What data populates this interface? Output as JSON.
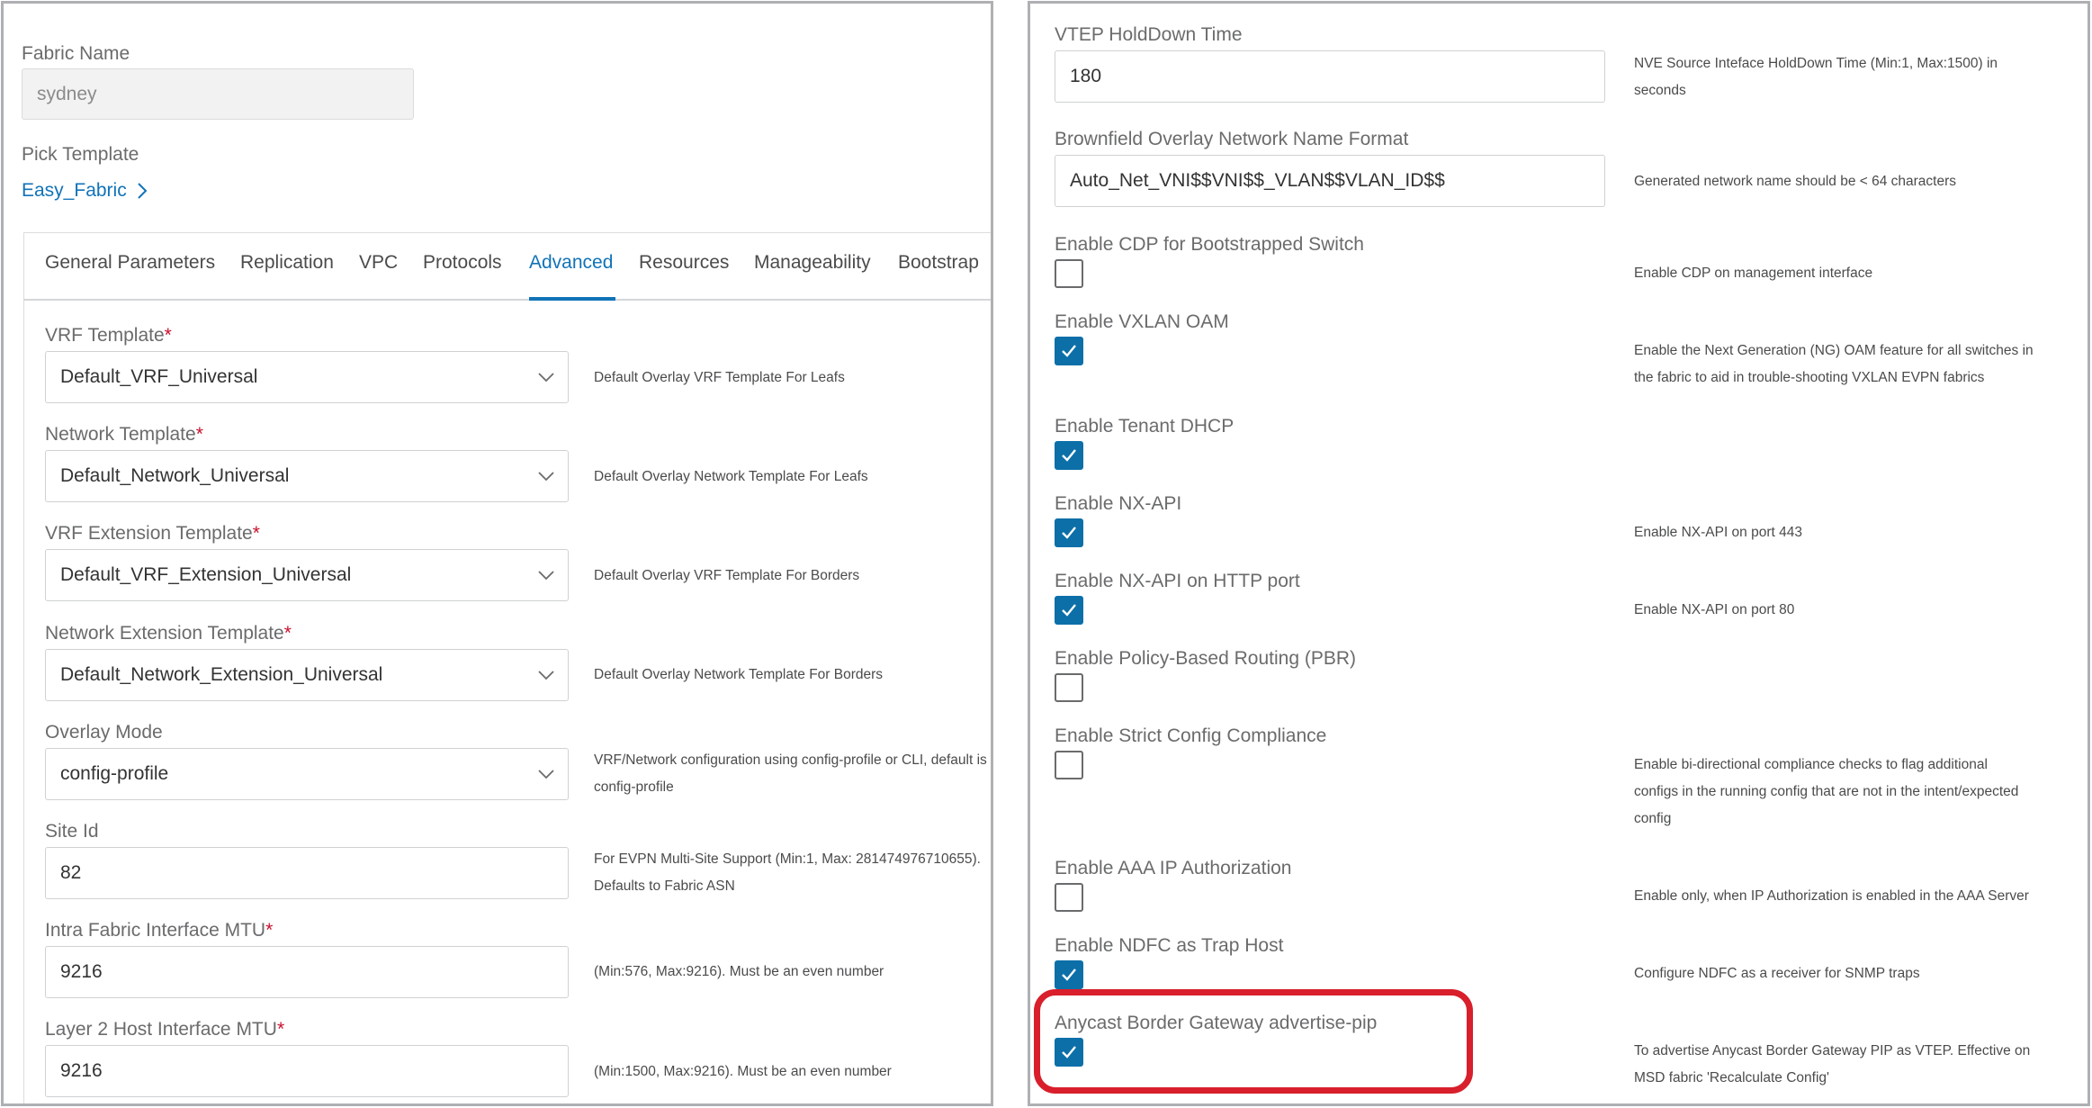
{
  "left": {
    "fabric_name_label": "Fabric Name",
    "fabric_name_value": "sydney",
    "pick_template_label": "Pick Template",
    "template_link": "Easy_Fabric",
    "tabs": [
      {
        "label": "General Parameters"
      },
      {
        "label": "Replication"
      },
      {
        "label": "VPC"
      },
      {
        "label": "Protocols"
      },
      {
        "label": "Advanced"
      },
      {
        "label": "Resources"
      },
      {
        "label": "Manageability"
      },
      {
        "label": "Bootstrap"
      }
    ],
    "active_tab": "Advanced",
    "fields": {
      "vrf_template": {
        "label": "VRF Template",
        "value": "Default_VRF_Universal",
        "hint": "Default Overlay VRF Template For Leafs"
      },
      "network_template": {
        "label": "Network Template",
        "value": "Default_Network_Universal",
        "hint": "Default Overlay Network Template For Leafs"
      },
      "vrf_ext_template": {
        "label": "VRF Extension Template",
        "value": "Default_VRF_Extension_Universal",
        "hint": "Default Overlay VRF Template For Borders"
      },
      "net_ext_template": {
        "label": "Network Extension Template",
        "value": "Default_Network_Extension_Universal",
        "hint": "Default Overlay Network Template For Borders"
      },
      "overlay_mode": {
        "label": "Overlay Mode",
        "value": "config-profile",
        "hint_1": "VRF/Network configuration using config-profile or CLI, default is",
        "hint_2": "config-profile"
      },
      "site_id": {
        "label": "Site Id",
        "value": "82",
        "hint_1": "For EVPN Multi-Site Support (Min:1, Max: 281474976710655).",
        "hint_2": "Defaults to Fabric ASN"
      },
      "intra_mtu": {
        "label": "Intra Fabric Interface MTU",
        "value": "9216",
        "hint": "(Min:576, Max:9216). Must be an even number"
      },
      "l2_mtu": {
        "label": "Layer 2 Host Interface MTU",
        "value": "9216",
        "hint": "(Min:1500, Max:9216). Must be an even number"
      }
    },
    "required_mark": "*"
  },
  "right": {
    "vtep_holddown": {
      "label": "VTEP HoldDown Time",
      "value": "180",
      "hint_1": "NVE Source Inteface HoldDown Time (Min:1, Max:1500) in",
      "hint_2": "seconds"
    },
    "brownfield_format": {
      "label": "Brownfield Overlay Network Name Format",
      "value": "Auto_Net_VNI$$VNI$$_VLAN$$VLAN_ID$$",
      "hint": "Generated network name should be < 64 characters"
    },
    "checkboxes": [
      {
        "label": "Enable CDP for Bootstrapped Switch",
        "checked": false,
        "hint_1": "Enable CDP on management interface",
        "hint_2": "",
        "hint_3": ""
      },
      {
        "label": "Enable VXLAN OAM",
        "checked": true,
        "hint_1": "Enable the Next Generation (NG) OAM feature for all switches in",
        "hint_2": "the fabric to aid in trouble-shooting VXLAN EVPN fabrics",
        "hint_3": ""
      },
      {
        "label": "Enable Tenant DHCP",
        "checked": true,
        "hint_1": "",
        "hint_2": "",
        "hint_3": ""
      },
      {
        "label": "Enable NX-API",
        "checked": true,
        "hint_1": "Enable NX-API on port 443",
        "hint_2": "",
        "hint_3": ""
      },
      {
        "label": "Enable NX-API on HTTP port",
        "checked": true,
        "hint_1": "Enable NX-API on port 80",
        "hint_2": "",
        "hint_3": ""
      },
      {
        "label": "Enable Policy-Based Routing (PBR)",
        "checked": false,
        "hint_1": "",
        "hint_2": "",
        "hint_3": ""
      },
      {
        "label": "Enable Strict Config Compliance",
        "checked": false,
        "hint_1": "Enable bi-directional compliance checks to flag additional",
        "hint_2": "configs in the running config that are not in the intent/expected",
        "hint_3": "config"
      },
      {
        "label": "Enable AAA IP Authorization",
        "checked": false,
        "hint_1": "Enable only, when IP Authorization is enabled in the AAA Server",
        "hint_2": "",
        "hint_3": ""
      },
      {
        "label": "Enable NDFC as Trap Host",
        "checked": true,
        "hint_1": "Configure NDFC as a receiver for SNMP traps",
        "hint_2": "",
        "hint_3": ""
      },
      {
        "label": "Anycast Border Gateway advertise-pip",
        "checked": true,
        "hint_1": "To advertise Anycast Border Gateway PIP as VTEP. Effective on",
        "hint_2": "MSD fabric 'Recalculate Config'",
        "hint_3": ""
      }
    ]
  },
  "colors": {
    "accent": "#1173b8",
    "checkbox": "#0c6fa8",
    "required": "#c8102e",
    "highlight": "#d81f2b"
  },
  "icons": {
    "chevron": "chevron-down-icon",
    "link_arrow": "chevron-right-icon",
    "check": "checkmark-icon"
  }
}
